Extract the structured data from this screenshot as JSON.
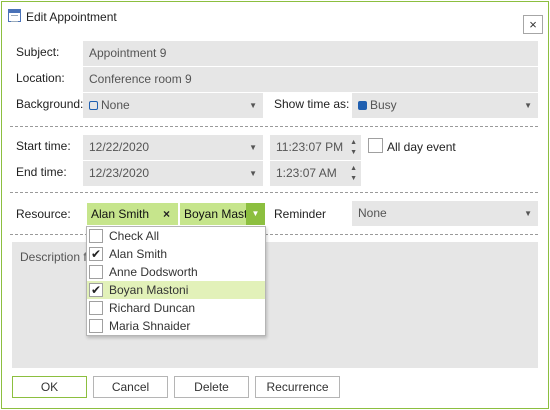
{
  "window": {
    "title": "Edit Appointment",
    "close_glyph": "×"
  },
  "subject": {
    "label": "Subject:",
    "value": "Appointment 9"
  },
  "location": {
    "label": "Location:",
    "value": "Conference room 9"
  },
  "background": {
    "label": "Background:",
    "value": "None",
    "swatch_color": "#ffffff"
  },
  "show_time_as": {
    "label": "Show time as:",
    "value": "Busy",
    "swatch_color": "#1f5fb0"
  },
  "start": {
    "label": "Start time:",
    "date": "12/22/2020",
    "time": "11:23:07 PM"
  },
  "end": {
    "label": "End time:",
    "date": "12/23/2020",
    "time": "1:23:07 AM"
  },
  "all_day": {
    "label": "All day event",
    "checked": false
  },
  "resource": {
    "label": "Resource:",
    "selected_tags": [
      "Alan Smith",
      "Boyan Mastoni"
    ],
    "tag_remove_glyph": "×"
  },
  "reminder": {
    "label": "Reminder",
    "value": "None"
  },
  "description": {
    "placeholder": "Description f"
  },
  "resource_dropdown": {
    "items": [
      {
        "label": "Check All",
        "checked": false,
        "highlighted": false
      },
      {
        "label": "Alan Smith",
        "checked": true,
        "highlighted": false
      },
      {
        "label": "Anne Dodsworth",
        "checked": false,
        "highlighted": false
      },
      {
        "label": "Boyan Mastoni",
        "checked": true,
        "highlighted": true
      },
      {
        "label": "Richard Duncan",
        "checked": false,
        "highlighted": false
      },
      {
        "label": "Maria Shnaider",
        "checked": false,
        "highlighted": false
      }
    ]
  },
  "buttons": {
    "ok": "OK",
    "cancel": "Cancel",
    "delete": "Delete",
    "recurrence": "Recurrence"
  },
  "glyphs": {
    "dropdown_arrow": "▼",
    "spin_up": "▲",
    "spin_down": "▼",
    "checkmark": "✔"
  },
  "colors": {
    "accent": "#8cbf3f",
    "tag_bg": "#c6e58c",
    "field_bg": "#e6e6e6",
    "highlight": "#e2f1b9"
  }
}
